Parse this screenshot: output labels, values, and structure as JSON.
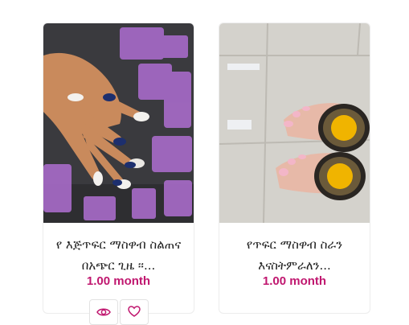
{
  "products": [
    {
      "title": "የ እጅጥፍር ማስዋብ ስልጠና በአጭር ጊዜ ፡፡...",
      "price": "1.00 month"
    },
    {
      "title": "የጥፍር ማስዋብ ስራን እናስትምራለን...",
      "price": "1.00 month"
    }
  ],
  "actions": {
    "view_icon": "eye-icon",
    "wishlist_icon": "heart-icon"
  },
  "colors": {
    "accent": "#c0176f"
  }
}
